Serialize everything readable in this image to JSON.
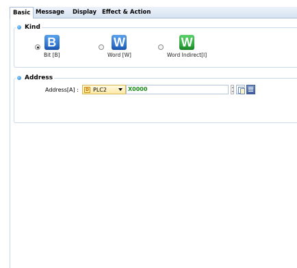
{
  "tabs": [
    {
      "label": "Basic",
      "active": true
    },
    {
      "label": "Message",
      "active": false
    },
    {
      "label": "Display",
      "active": false
    },
    {
      "label": "Effect & Action",
      "active": false
    }
  ],
  "kind": {
    "title": "Kind",
    "options": [
      {
        "icon_letter": "B",
        "label": "Bit [B]",
        "selected": true,
        "icon": "bit-icon",
        "color": "#2f78d8"
      },
      {
        "icon_letter": "W",
        "label": "Word [W]",
        "selected": false,
        "icon": "word-icon",
        "color": "#2f78d8"
      },
      {
        "icon_letter": "W",
        "label": "Word Indirect[I]",
        "selected": false,
        "icon": "word-indirect-icon",
        "color": "#2aa83a"
      }
    ]
  },
  "address": {
    "title": "Address",
    "label": "Address[A] :",
    "plc": {
      "icon_letter": "D",
      "value": "PLC2"
    },
    "value": "X0000",
    "value_color": "#1a8c1a"
  }
}
